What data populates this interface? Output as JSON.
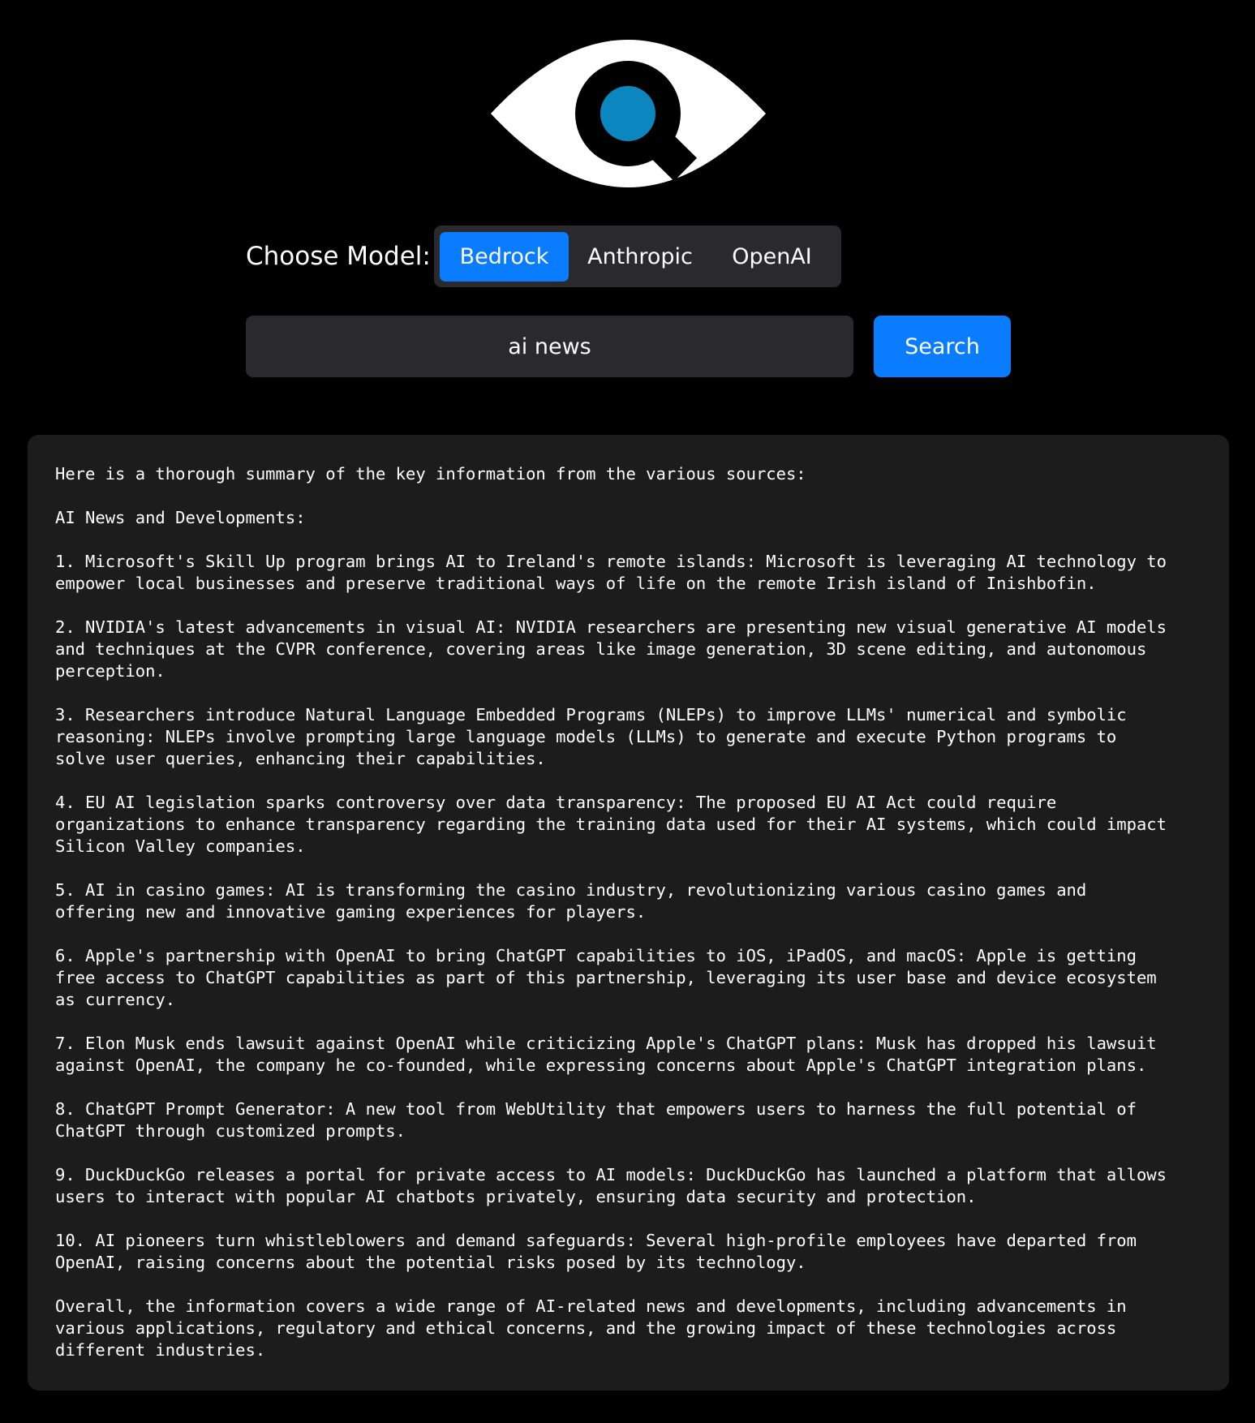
{
  "colors": {
    "background": "#000000",
    "panel": "#2a2a2c",
    "accent": "#0a7cff",
    "results_bg": "#1c1c1d",
    "logo_eye": "#ffffff",
    "logo_iris": "#0b86bf"
  },
  "logo": {
    "icon": "eye-search-logo-icon"
  },
  "model_selector": {
    "label": "Choose Model:",
    "selected": "Bedrock",
    "options": [
      "Bedrock",
      "Anthropic",
      "OpenAI"
    ]
  },
  "search": {
    "value": "ai news",
    "button_label": "Search"
  },
  "results": {
    "text": "Here is a thorough summary of the key information from the various sources:\n\nAI News and Developments:\n\n1. Microsoft's Skill Up program brings AI to Ireland's remote islands: Microsoft is leveraging AI technology to\nempower local businesses and preserve traditional ways of life on the remote Irish island of Inishbofin.\n\n2. NVIDIA's latest advancements in visual AI: NVIDIA researchers are presenting new visual generative AI models\nand techniques at the CVPR conference, covering areas like image generation, 3D scene editing, and autonomous\nperception.\n\n3. Researchers introduce Natural Language Embedded Programs (NLEPs) to improve LLMs' numerical and symbolic\nreasoning: NLEPs involve prompting large language models (LLMs) to generate and execute Python programs to\nsolve user queries, enhancing their capabilities.\n\n4. EU AI legislation sparks controversy over data transparency: The proposed EU AI Act could require\norganizations to enhance transparency regarding the training data used for their AI systems, which could impact\nSilicon Valley companies.\n\n5. AI in casino games: AI is transforming the casino industry, revolutionizing various casino games and\noffering new and innovative gaming experiences for players.\n\n6. Apple's partnership with OpenAI to bring ChatGPT capabilities to iOS, iPadOS, and macOS: Apple is getting\nfree access to ChatGPT capabilities as part of this partnership, leveraging its user base and device ecosystem\nas currency.\n\n7. Elon Musk ends lawsuit against OpenAI while criticizing Apple's ChatGPT plans: Musk has dropped his lawsuit\nagainst OpenAI, the company he co-founded, while expressing concerns about Apple's ChatGPT integration plans.\n\n8. ChatGPT Prompt Generator: A new tool from WebUtility that empowers users to harness the full potential of\nChatGPT through customized prompts.\n\n9. DuckDuckGo releases a portal for private access to AI models: DuckDuckGo has launched a platform that allows\nusers to interact with popular AI chatbots privately, ensuring data security and protection.\n\n10. AI pioneers turn whistleblowers and demand safeguards: Several high-profile employees have departed from\nOpenAI, raising concerns about the potential risks posed by its technology.\n\nOverall, the information covers a wide range of AI-related news and developments, including advancements in\nvarious applications, regulatory and ethical concerns, and the growing impact of these technologies across\ndifferent industries."
  }
}
